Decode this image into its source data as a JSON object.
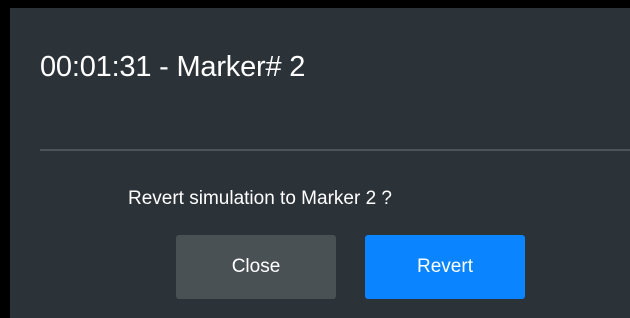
{
  "dialog": {
    "title": "00:01:31 - Marker# 2",
    "message": "Revert simulation to Marker 2 ?",
    "close_label": "Close",
    "revert_label": "Revert"
  },
  "colors": {
    "dialog_background": "#2b3238",
    "close_button": "#4a5155",
    "revert_button": "#0a84ff",
    "divider": "#4e5559"
  }
}
